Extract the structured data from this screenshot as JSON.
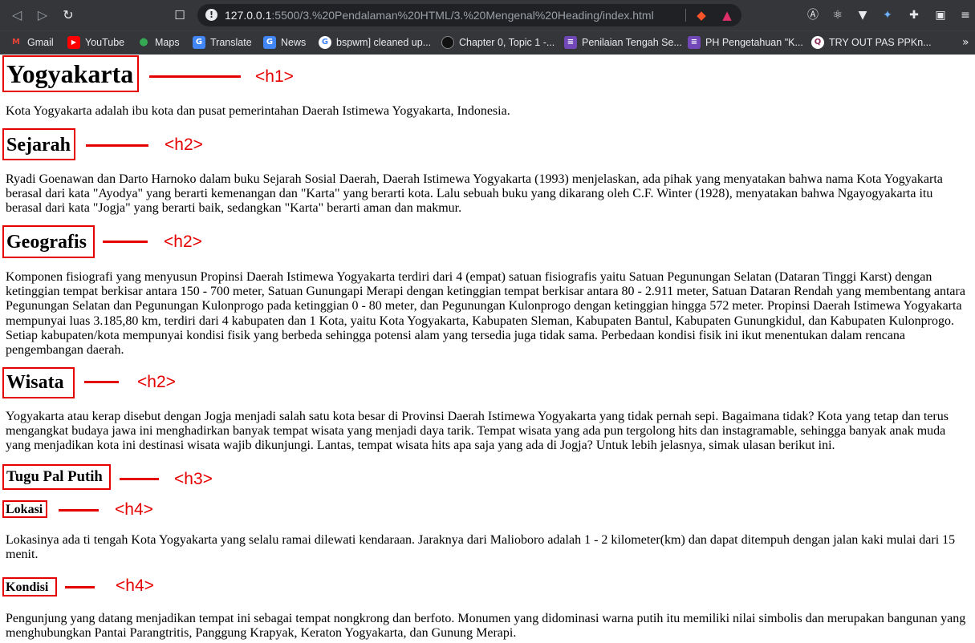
{
  "browser": {
    "url_host": "127.0.0.1",
    "url_rest": ":5500/3.%20Pendalaman%20HTML/3.%20Mengenal%20Heading/index.html",
    "bookmarks": [
      {
        "label": "Gmail",
        "icon": "gmail-icon",
        "glyph": "M",
        "color": "#ea4335"
      },
      {
        "label": "YouTube",
        "icon": "youtube-icon",
        "glyph": "▶",
        "color": "#ff0000"
      },
      {
        "label": "Maps",
        "icon": "maps-icon",
        "glyph": "●",
        "color": "#34a853"
      },
      {
        "label": "Translate",
        "icon": "translate-icon",
        "glyph": "G",
        "color": "#4285f4"
      },
      {
        "label": "News",
        "icon": "news-icon",
        "glyph": "G",
        "color": "#4285f4"
      },
      {
        "label": "bspwm] cleaned up...",
        "icon": "google-icon",
        "glyph": "G",
        "color": "#ffffff"
      },
      {
        "label": "Chapter 0, Topic 1 -...",
        "icon": "github-icon",
        "glyph": "●",
        "color": "#111111"
      },
      {
        "label": "Penilaian Tengah Se...",
        "icon": "forms-icon",
        "glyph": "≡",
        "color": "#7248b9"
      },
      {
        "label": "PH Pengetahuan \"K...",
        "icon": "forms-icon",
        "glyph": "≡",
        "color": "#7248b9"
      },
      {
        "label": "TRY OUT PAS PPKn...",
        "icon": "quizizz-icon",
        "glyph": "Q",
        "color": "#8a2a5a"
      }
    ]
  },
  "page": {
    "h1": "Yogyakarta",
    "intro": "Kota Yogyakarta adalah ibu kota dan pusat pemerintahan Daerah Istimewa Yogyakarta, Indonesia.",
    "sejarah_title": "Sejarah",
    "sejarah_text": "Ryadi Goenawan dan Darto Harnoko dalam buku Sejarah Sosial Daerah, Daerah Istimewa Yogyakarta (1993) menjelaskan, ada pihak yang menyatakan bahwa nama Kota Yogyakarta berasal dari kata \"Ayodya\" yang berarti kemenangan dan \"Karta\" yang berarti kota. Lalu sebuah buku yang dikarang oleh C.F. Winter (1928), menyatakan bahwa Ngayogyakarta itu berasal dari kata \"Jogja\" yang berarti baik, sedangkan \"Karta\" berarti aman dan makmur.",
    "geografis_title": "Geografis",
    "geografis_text": "Komponen fisiografi yang menyusun Propinsi Daerah Istimewa Yogyakarta terdiri dari 4 (empat) satuan fisiografis yaitu Satuan Pegunungan Selatan (Dataran Tinggi Karst) dengan ketinggian tempat berkisar antara 150 - 700 meter, Satuan Gunungapi Merapi dengan ketinggian tempat berkisar antara 80 - 2.911 meter, Satuan Dataran Rendah yang membentang antara Pegunungan Selatan dan Pegunungan Kulonprogo pada ketinggian 0 - 80 meter, dan Pegunungan Kulonprogo dengan ketinggian hingga 572 meter. Propinsi Daerah Istimewa Yogyakarta mempunyai luas 3.185,80 km, terdiri dari 4 kabupaten dan 1 Kota, yaitu Kota Yogyakarta, Kabupaten Sleman, Kabupaten Bantul, Kabupaten Gunungkidul, dan Kabupaten Kulonprogo. Setiap kabupaten/kota mempunyai kondisi fisik yang berbeda sehingga potensi alam yang tersedia juga tidak sama. Perbedaan kondisi fisik ini ikut menentukan dalam rencana pengembangan daerah.",
    "wisata_title": "Wisata",
    "wisata_text": "Yogyakarta atau kerap disebut dengan Jogja menjadi salah satu kota besar di Provinsi Daerah Istimewa Yogyakarta yang tidak pernah sepi. Bagaimana tidak? Kota yang tetap dan terus mengangkat budaya jawa ini menghadirkan banyak tempat wisata yang menjadi daya tarik. Tempat wisata yang ada pun tergolong hits dan instagramable, sehingga banyak anak muda yang menjadikan kota ini destinasi wisata wajib dikunjungi. Lantas, tempat wisata hits apa saja yang ada di Jogja? Untuk lebih jelasnya, simak ulasan berikut ini.",
    "tugu_title": "Tugu Pal Putih",
    "lokasi_title": "Lokasi",
    "lokasi_text": "Lokasinya ada ti tengah Kota Yogyakarta yang selalu ramai dilewati kendaraan. Jaraknya dari Malioboro adalah 1 - 2 kilometer(km) dan dapat ditempuh dengan jalan kaki mulai dari 15 menit.",
    "kondisi_title": "Kondisi",
    "kondisi_text": "Pengunjung yang datang menjadikan tempat ini sebagai tempat nongkrong dan berfoto. Monumen yang didominasi warna putih itu memiliki nilai simbolis dan merupakan bangunan yang menghubungkan Pantai Parangtritis, Panggung Krapyak, Keraton Yogyakarta, dan Gunung Merapi."
  },
  "annotations": {
    "h1": "<h1>",
    "h2": "<h2>",
    "h3": "<h3>",
    "h4": "<h4>",
    "color": "#e50000"
  }
}
